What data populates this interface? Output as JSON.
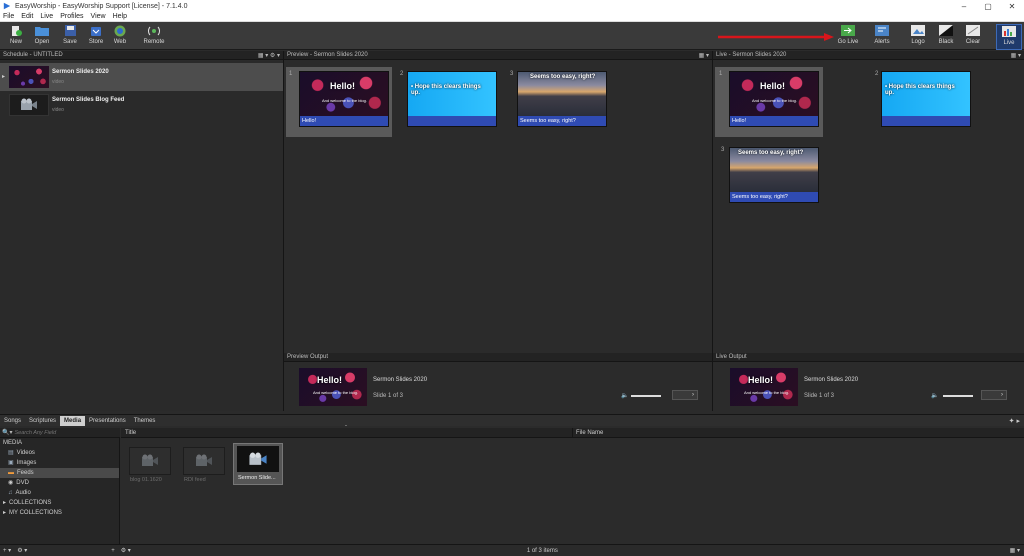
{
  "window": {
    "title": "EasyWorship - EasyWorship Support [License] - 7.1.4.0"
  },
  "menu": [
    "File",
    "Edit",
    "Live",
    "Profiles",
    "View",
    "Help"
  ],
  "toolbar": {
    "new": "New",
    "open": "Open",
    "save": "Save",
    "store": "Store",
    "web": "Web",
    "remote": "Remote",
    "go_live": "Go Live",
    "alerts": "Alerts",
    "logo": "Logo",
    "black": "Black",
    "clear": "Clear",
    "live": "Live"
  },
  "schedule": {
    "header": "Schedule - UNTITLED",
    "items": [
      {
        "title": "Sermon Slides 2020",
        "type": "video"
      },
      {
        "title": "Sermon Slides Blog Feed",
        "type": "video"
      }
    ]
  },
  "preview": {
    "header": "Preview - Sermon Slides 2020",
    "slides": [
      {
        "num": "1",
        "title": "Hello!",
        "subtitle": "And welcome to the blog.",
        "caption": "Hello!"
      },
      {
        "num": "2",
        "title": "• Hope this clears things up.",
        "caption": ""
      },
      {
        "num": "3",
        "title": "Seems too easy, right?",
        "caption": "Seems too easy, right?"
      }
    ]
  },
  "live": {
    "header": "Live - Sermon Slides 2020",
    "slides": [
      {
        "num": "1",
        "title": "Hello!",
        "subtitle": "And welcome to the blog.",
        "caption": "Hello!"
      },
      {
        "num": "2",
        "title": "• Hope this clears things up.",
        "caption": ""
      },
      {
        "num": "3",
        "title": "Seems too easy, right?",
        "caption": "Seems too easy, right?"
      }
    ]
  },
  "preview_output": {
    "header": "Preview Output",
    "name": "Sermon Slides 2020",
    "slide": "Slide 1 of 3",
    "thumb_title": "Hello!",
    "thumb_sub": "And welcome to the blog."
  },
  "live_output": {
    "header": "Live Output",
    "name": "Sermon Slides 2020",
    "slide": "Slide 1 of 3",
    "thumb_title": "Hello!",
    "thumb_sub": "And welcome to the blog."
  },
  "library": {
    "tabs": [
      "Songs",
      "Scriptures",
      "Media",
      "Presentations",
      "Themes"
    ],
    "active_tab": "Media",
    "search_placeholder": "Search Any Field",
    "columns": {
      "title": "Title",
      "file_name": "File Name"
    },
    "tree": {
      "root": "MEDIA",
      "items": [
        "Videos",
        "Images",
        "Feeds",
        "DVD",
        "Audio"
      ],
      "selected": "Feeds",
      "collections": "COLLECTIONS",
      "my_collections": "MY COLLECTIONS"
    },
    "media": [
      {
        "label": "blog 01.1620"
      },
      {
        "label": "RDI feed"
      },
      {
        "label": "Sermon Slide..."
      }
    ],
    "status": "1 of 3 items"
  }
}
